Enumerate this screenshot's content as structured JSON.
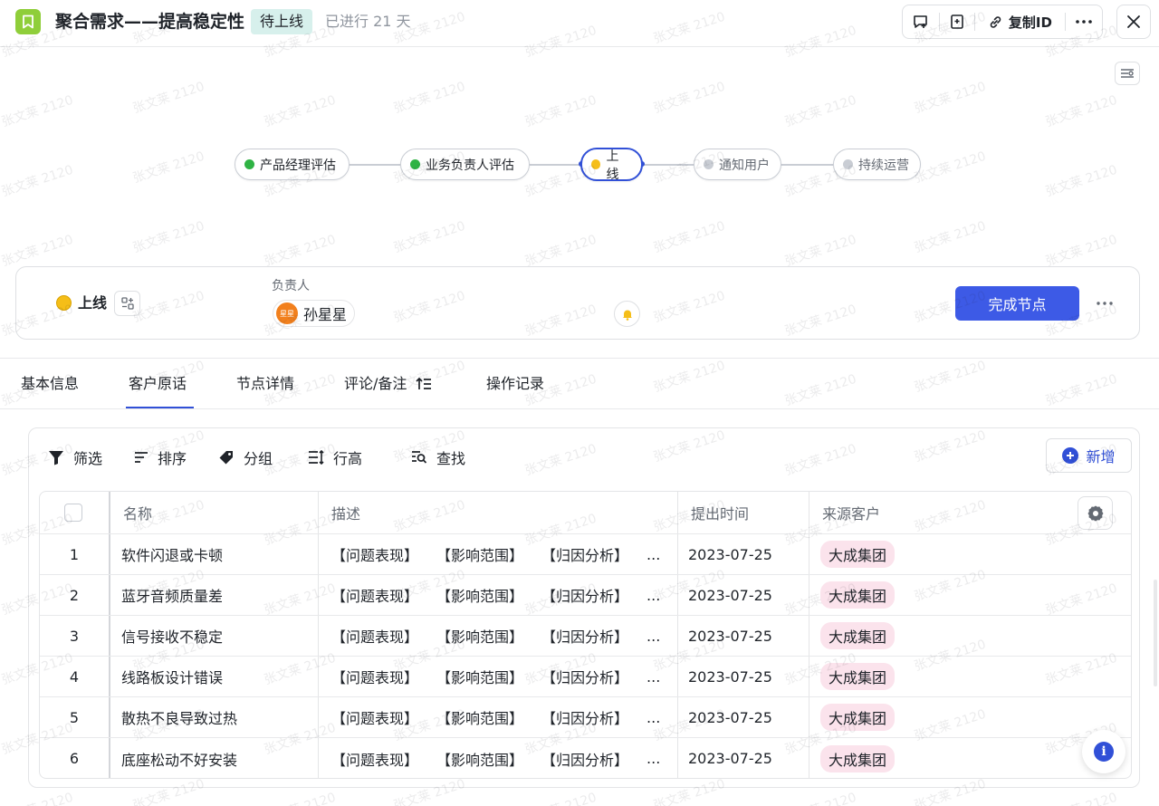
{
  "header": {
    "title": "聚合需求——提高稳定性",
    "status": "待上线",
    "elapsed": "已进行 21 天",
    "copy_id": "复制ID"
  },
  "flow": {
    "nodes": [
      {
        "label": "产品经理评估",
        "state": "done"
      },
      {
        "label": "业务负责人评估",
        "state": "done"
      },
      {
        "label": "上线",
        "state": "current"
      },
      {
        "label": "通知用户",
        "state": "pending"
      },
      {
        "label": "持续运营",
        "state": "pending"
      }
    ]
  },
  "node_card": {
    "status": "上线",
    "owner_label": "负责人",
    "avatar_text": "星星",
    "owner_name": "孙星星",
    "complete_label": "完成节点"
  },
  "tabs": [
    {
      "label": "基本信息"
    },
    {
      "label": "客户原话",
      "active": true
    },
    {
      "label": "节点详情"
    },
    {
      "label": "评论/备注"
    },
    {
      "label": "操作记录"
    }
  ],
  "panel": {
    "tools": {
      "filter": "筛选",
      "sort": "排序",
      "group": "分组",
      "row_height": "行高",
      "search": "查找"
    },
    "add_label": "新增"
  },
  "table": {
    "columns": {
      "name": "名称",
      "desc": "描述",
      "time": "提出时间",
      "customer": "来源客户"
    },
    "desc_parts": [
      "【问题表现】",
      "【影响范围】",
      "【归因分析】",
      "..."
    ],
    "rows": [
      {
        "index": "1",
        "name": "软件闪退或卡顿",
        "time": "2023-07-25",
        "customer": "大成集团"
      },
      {
        "index": "2",
        "name": "蓝牙音频质量差",
        "time": "2023-07-25",
        "customer": "大成集团"
      },
      {
        "index": "3",
        "name": "信号接收不稳定",
        "time": "2023-07-25",
        "customer": "大成集团"
      },
      {
        "index": "4",
        "name": "线路板设计错误",
        "time": "2023-07-25",
        "customer": "大成集团"
      },
      {
        "index": "5",
        "name": "散热不良导致过热",
        "time": "2023-07-25",
        "customer": "大成集团"
      },
      {
        "index": "6",
        "name": "底座松动不好安装",
        "time": "2023-07-25",
        "customer": "大成集团"
      }
    ]
  },
  "watermark": "张文莱 2120",
  "colors": {
    "accent": "#3150d7",
    "done": "#2fb344",
    "current": "#f5be18",
    "pending": "#c9cdd4",
    "status_tag_bg": "#d7f0ec",
    "customer_tag_bg": "#fbe3ec",
    "app_icon": "#8fce3a"
  }
}
